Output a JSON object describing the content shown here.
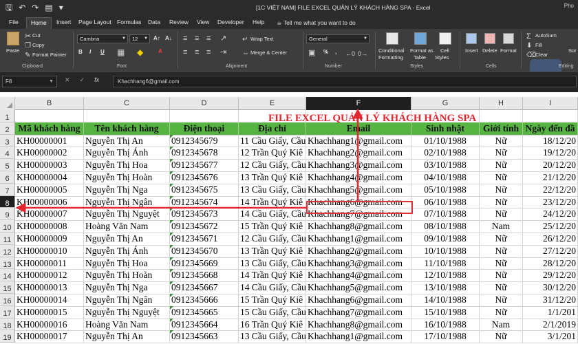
{
  "titlebar": {
    "title": "[1C VIỆT NAM] FILE EXCEL QUẢN LÝ KHÁCH HÀNG SPA  -  Excel",
    "user": "Pho",
    "qat": {
      "save": "save-icon",
      "undo": "undo-icon",
      "redo": "redo-icon",
      "form": "form-icon",
      "customize": "customize-icon"
    }
  },
  "tabs": [
    "File",
    "Home",
    "Insert",
    "Page Layout",
    "Formulas",
    "Data",
    "Review",
    "View",
    "Developer",
    "Help"
  ],
  "tell_me": "Tell me what you want to do",
  "ribbon": {
    "clipboard": {
      "paste": "Paste",
      "cut": "Cut",
      "copy": "Copy",
      "format_painter": "Format Painter",
      "label": "Clipboard"
    },
    "font": {
      "name": "Cambria",
      "size": "12",
      "bold": "B",
      "italic": "I",
      "underline": "U",
      "label": "Font"
    },
    "alignment": {
      "wrap": "Wrap Text",
      "merge": "Merge & Center",
      "label": "Alignment"
    },
    "number": {
      "format": "General",
      "percent": "%",
      "comma": ",",
      "label": "Number"
    },
    "styles": {
      "conditional_1": "Conditional",
      "conditional_2": "Formatting",
      "format_as_1": "Format as",
      "format_as_2": "Table",
      "cell_styles_1": "Cell",
      "cell_styles_2": "Styles",
      "label": "Styles"
    },
    "cells": {
      "insert": "Insert",
      "delete": "Delete",
      "format": "Format",
      "label": "Cells"
    },
    "editing": {
      "autosum": "AutoSum",
      "fill": "Fill",
      "clear": "Clear",
      "sort": "Sor",
      "label": "Editing"
    }
  },
  "formula_bar": {
    "name_box": "F8",
    "cancel": "✕",
    "enter": "✓",
    "fx": "fx",
    "content": "Khachhang6@gmail.com"
  },
  "sheet": {
    "columns": [
      "B",
      "C",
      "D",
      "E",
      "F",
      "G",
      "H",
      "I"
    ],
    "selected_column": "F",
    "selected_row": "8",
    "row_numbers": [
      "1",
      "2",
      "3",
      "4",
      "5",
      "6",
      "7",
      "8",
      "9",
      "10",
      "11",
      "12",
      "13",
      "14",
      "15",
      "16",
      "17",
      "18",
      "19"
    ],
    "title": "FILE EXCEL QUẢN LÝ KHÁCH HÀNG SPA",
    "headers": [
      "Mã khách hàng",
      "Tên khách hàng",
      "Điện thoại",
      "Địa chỉ",
      "Email",
      "Sinh nhật",
      "Giới tính",
      "Ngày đến đầ"
    ],
    "rows": [
      [
        "KH00000001",
        "Nguyễn Thị An",
        "0912345679",
        "11 Cầu Giấy, Cầu",
        "Khachhang1@gmail.com",
        "01/10/1988",
        "Nữ",
        "18/12/20"
      ],
      [
        "KH00000002",
        "Nguyễn Thị Ánh",
        "0912345678",
        "12 Trần Quý Kiê",
        "Khachhang2@gmail.com",
        "02/10/1988",
        "Nữ",
        "19/12/20"
      ],
      [
        "KH00000003",
        "Nguyễn Thị Hoa",
        "0912345677",
        "12 Cầu Giấy, Cầu",
        "Khachhang3@gmail.com",
        "03/10/1988",
        "Nữ",
        "20/12/20"
      ],
      [
        "KH00000004",
        "Nguyễn Thị Hoàn",
        "0912345676",
        "13 Trần Quý Kiê",
        "Khachhang4@gmail.com",
        "04/10/1988",
        "Nữ",
        "21/12/20"
      ],
      [
        "KH00000005",
        "Nguyễn Thị Nga",
        "0912345675",
        "13 Cầu Giấy, Cầu",
        "Khachhang5@gmail.com",
        "05/10/1988",
        "Nữ",
        "22/12/20"
      ],
      [
        "KH00000006",
        "Nguyễn Thị Ngân",
        "0912345674",
        "14 Trần Quý Kiê",
        "Khachhang6@gmail.com",
        "06/10/1988",
        "Nữ",
        "23/12/20"
      ],
      [
        "KH00000007",
        "Nguyễn Thị Nguyệt",
        "0912345673",
        "14 Cầu Giấy, Cầu",
        "Khachhang7@gmail.com",
        "07/10/1988",
        "Nữ",
        "24/12/20"
      ],
      [
        "KH00000008",
        "Hoàng Văn Nam",
        "0912345672",
        "15 Trần Quý Kiê",
        "Khachhang8@gmail.com",
        "08/10/1988",
        "Nam",
        "25/12/20"
      ],
      [
        "KH00000009",
        "Nguyễn Thị An",
        "0912345671",
        "12 Cầu Giấy, Cầu",
        "Khachhang1@gmail.com",
        "09/10/1988",
        "Nữ",
        "26/12/20"
      ],
      [
        "KH00000010",
        "Nguyễn Thị Ánh",
        "0912345670",
        "13 Trần Quý Kiê",
        "Khachhang2@gmail.com",
        "10/10/1988",
        "Nữ",
        "27/12/20"
      ],
      [
        "KH00000011",
        "Nguyễn Thị Hoa",
        "0912345669",
        "13 Cầu Giấy, Cầu",
        "Khachhang3@gmail.com",
        "11/10/1988",
        "Nữ",
        "28/12/20"
      ],
      [
        "KH00000012",
        "Nguyễn Thị Hoàn",
        "0912345668",
        "14 Trần Quý Kiê",
        "Khachhang4@gmail.com",
        "12/10/1988",
        "Nữ",
        "29/12/20"
      ],
      [
        "KH00000013",
        "Nguyễn Thị Nga",
        "0912345667",
        "14 Cầu Giấy, Cầu",
        "Khachhang5@gmail.com",
        "13/10/1988",
        "Nữ",
        "30/12/20"
      ],
      [
        "KH00000014",
        "Nguyễn Thị Ngân",
        "0912345666",
        "15 Trần Quý Kiê",
        "Khachhang6@gmail.com",
        "14/10/1988",
        "Nữ",
        "31/12/20"
      ],
      [
        "KH00000015",
        "Nguyễn Thị Nguyệt",
        "0912345665",
        "15 Cầu Giấy, Cầu",
        "Khachhang7@gmail.com",
        "15/10/1988",
        "Nữ",
        "1/1/201"
      ],
      [
        "KH00000016",
        "Hoàng Văn Nam",
        "0912345664",
        "16 Trần Quý Kiê",
        "Khachhang8@gmail.com",
        "16/10/1988",
        "Nam",
        "2/1/2019"
      ],
      [
        "KH00000017",
        "Nguyễn Thị An",
        "0912345663",
        "13 Cầu Giấy, Cầu",
        "Khachhang1@gmail.com",
        "17/10/1988",
        "Nữ",
        "3/1/201"
      ]
    ]
  },
  "colors": {
    "accent_red": "#e2262e",
    "header_green": "#57b443",
    "ribbon_dark": "#3d3d3d",
    "titlebar_dark": "#2b2b2b"
  }
}
